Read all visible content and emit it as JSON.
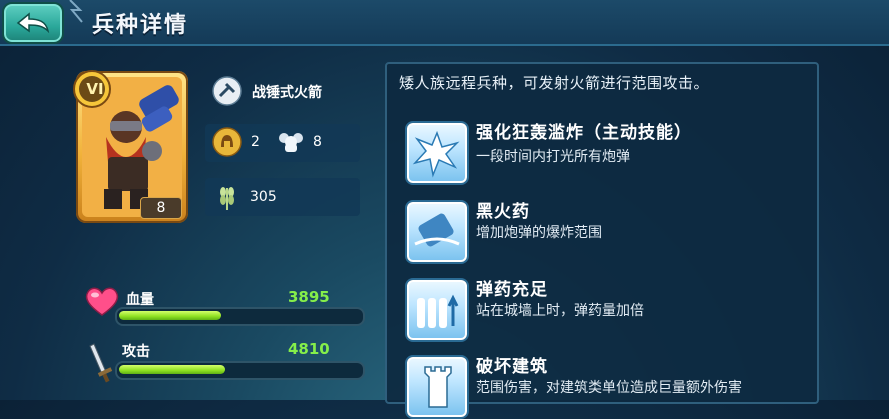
{
  "header": {
    "title": "兵种详情"
  },
  "unit": {
    "rank": "VI",
    "level": "8",
    "weapon_type": "战锤式火箭",
    "food_cost": "2",
    "population": "8",
    "upkeep": "305"
  },
  "stats": {
    "hp": {
      "label": "血量",
      "value": "3895",
      "fill_fraction": 0.42
    },
    "attack": {
      "label": "攻击",
      "value": "4810",
      "fill_fraction": 0.44
    }
  },
  "description": "矮人族远程兵种，可发射火箭进行范围攻击。",
  "skills": [
    {
      "name": "强化狂轰滥炸（主动技能）",
      "desc": "一段时间内打光所有炮弹",
      "icon": "explosion-icon"
    },
    {
      "name": "黑火药",
      "desc": "增加炮弹的爆炸范围",
      "icon": "gunpowder-icon"
    },
    {
      "name": "弹药充足",
      "desc": "站在城墙上时，弹药量加倍",
      "icon": "ammo-icon"
    },
    {
      "name": "破坏建筑",
      "desc": "范围伤害，对建筑类单位造成巨量额外伤害",
      "icon": "tower-icon"
    }
  ],
  "colors": {
    "accent_green": "#85ef4a",
    "bar_green": "#8ee021",
    "gold": "#f1b23a"
  }
}
